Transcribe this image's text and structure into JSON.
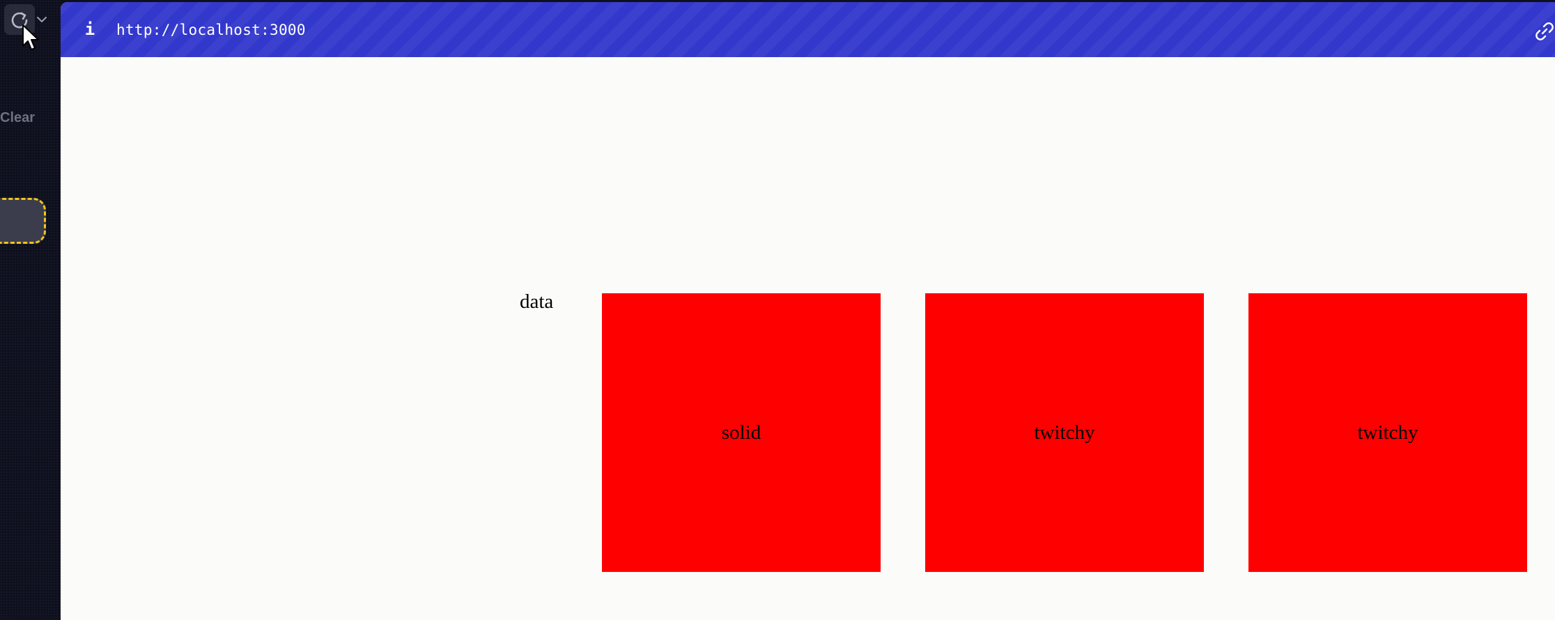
{
  "sidebar": {
    "clear_label": "Clear",
    "reload_icon": "reload-icon",
    "chevron_icon": "chevron-down-icon"
  },
  "browser": {
    "url": "http://localhost:3000",
    "info_icon_glyph": "i",
    "bar_color": "#3338cc"
  },
  "page": {
    "label": "data",
    "boxes": [
      {
        "label": "solid",
        "color": "#ff0000"
      },
      {
        "label": "twitchy",
        "color": "#ff0000"
      },
      {
        "label": "twitchy",
        "color": "#ff0000"
      }
    ]
  },
  "colors": {
    "sidebar_bg": "#0f101d",
    "selection_outline": "#f5c518",
    "content_bg": "#fbfbf9"
  }
}
